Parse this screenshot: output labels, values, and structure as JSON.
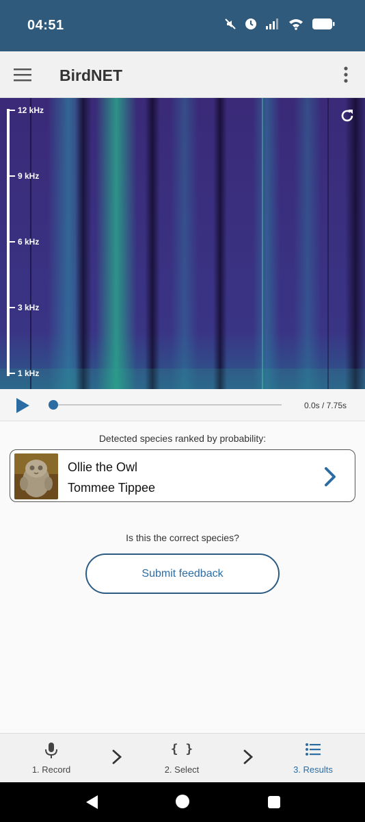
{
  "status_bar": {
    "time": "04:51",
    "icons": [
      "mute-icon",
      "alarm-icon",
      "signal-icon",
      "wifi-icon",
      "battery-icon"
    ]
  },
  "app_bar": {
    "title": "BirdNET",
    "menu_icon": "hamburger-menu-icon",
    "overflow_icon": "more-vert-icon"
  },
  "spectrogram": {
    "freq_labels": [
      "12 kHz",
      "9 kHz",
      "6 kHz",
      "3 kHz",
      "1 kHz"
    ],
    "refresh_icon": "refresh-icon",
    "colors": {
      "base": "#3b2a7a",
      "accent": "#2aa68a"
    }
  },
  "player": {
    "time": "0.0s / 7.75s",
    "progress": 0.0
  },
  "results": {
    "heading": "Detected species ranked by probability:",
    "species": [
      {
        "name": "Ollie the Owl",
        "subtitle": "Tommee Tippee"
      }
    ]
  },
  "feedback": {
    "question": "Is this the correct species?",
    "button_label": "Submit feedback"
  },
  "bottom_nav": {
    "items": [
      {
        "label": "1. Record",
        "icon": "microphone-icon",
        "active": false
      },
      {
        "label": "2. Select",
        "icon": "braces-icon",
        "active": false
      },
      {
        "label": "3. Results",
        "icon": "list-icon",
        "active": true
      }
    ]
  },
  "colors": {
    "status_bar": "#2f5a7c",
    "accent": "#2b6ca3"
  }
}
